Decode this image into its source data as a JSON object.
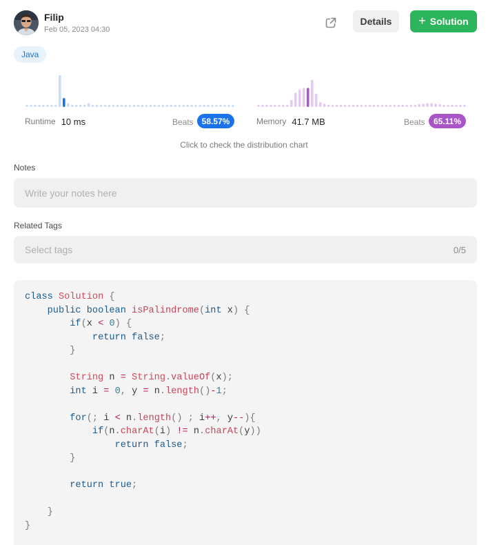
{
  "user": {
    "name": "Filip",
    "date": "Feb 05, 2023 04:30"
  },
  "actions": {
    "details_label": "Details",
    "solution_plus": "+",
    "solution_label": "Solution",
    "share_icon": "share-icon"
  },
  "language_tag": "Java",
  "runtime": {
    "label": "Runtime",
    "value": "10 ms",
    "beats_label": "Beats",
    "beats": "58.57%",
    "color": "#1a73e8",
    "light_color": "#c6dff7",
    "distribution": [
      0,
      0,
      0,
      0,
      0,
      0,
      0,
      0,
      1.0,
      0.28,
      0.12,
      0,
      0,
      0,
      0,
      0.12,
      0,
      0,
      0,
      0,
      0,
      0,
      0,
      0,
      0,
      0,
      0,
      0,
      0,
      0,
      0,
      0,
      0,
      0,
      0,
      0,
      0,
      0,
      0,
      0,
      0,
      0,
      0,
      0,
      0,
      0,
      0,
      0,
      0,
      0,
      0
    ],
    "highlight_index": 9
  },
  "memory": {
    "label": "Memory",
    "value": "41.7 MB",
    "beats_label": "Beats",
    "beats": "65.11%",
    "color": "#a855c8",
    "light_color": "#e6c9f3",
    "distribution": [
      0,
      0,
      0,
      0,
      0,
      0,
      0,
      0,
      0.22,
      0.45,
      0.55,
      0.6,
      0.6,
      0.85,
      0.42,
      0.15,
      0.1,
      0,
      0,
      0,
      0,
      0,
      0,
      0,
      0,
      0,
      0,
      0,
      0,
      0,
      0,
      0,
      0,
      0,
      0,
      0,
      0,
      0,
      0,
      0.06,
      0.1,
      0.12,
      0.12,
      0.1,
      0.06,
      0,
      0,
      0,
      0,
      0,
      0
    ],
    "highlight_index": 12
  },
  "distribution_hint": "Click to check the distribution chart",
  "notes": {
    "label": "Notes",
    "placeholder": "Write your notes here"
  },
  "tags": {
    "label": "Related Tags",
    "placeholder": "Select tags",
    "count": "0/5"
  },
  "code": {
    "language": "java",
    "lines": [
      "class Solution {",
      "    public boolean isPalindrome(int x) {",
      "        if(x < 0) {",
      "            return false;",
      "        }",
      "",
      "        String n = String.valueOf(x);",
      "        int i = 0, y = n.length()-1;",
      "",
      "        for(; i < n.length() ; i++, y--){",
      "            if(n.charAt(i) != n.charAt(y))",
      "                return false;",
      "        }",
      "",
      "        return true;",
      "",
      "    }",
      "}"
    ]
  }
}
